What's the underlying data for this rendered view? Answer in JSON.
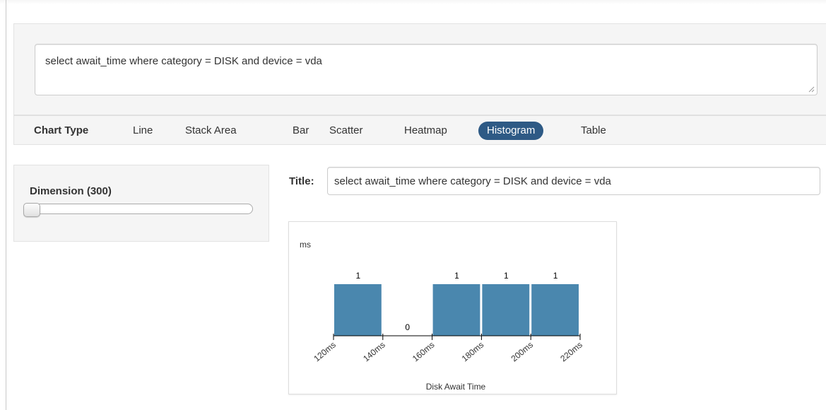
{
  "query": {
    "text": "select await_time where category = DISK and device = vda"
  },
  "chart_type_bar": {
    "label": "Chart Type",
    "options": [
      "Line",
      "Stack Area",
      "Bar",
      "Scatter",
      "Heatmap",
      "Histogram",
      "Table"
    ],
    "active": "Histogram",
    "active_color": "#2e5a85"
  },
  "dimension": {
    "label": "Dimension (300)",
    "slider_position": 0
  },
  "title_field": {
    "label": "Title:",
    "value": "select await_time where category = DISK and device = vda"
  },
  "chart_data": {
    "type": "bar",
    "ylabel": "ms",
    "xlabel": "Disk Await Time",
    "bin_edges": [
      120,
      140,
      160,
      180,
      200,
      220
    ],
    "tick_labels": [
      "120ms",
      "140ms",
      "160ms",
      "180ms",
      "200ms",
      "220ms"
    ],
    "values": [
      1,
      0,
      1,
      1,
      1
    ],
    "value_labels": [
      "1",
      "0",
      "1",
      "1",
      "1"
    ],
    "bar_color": "#4a87ae",
    "ylim": [
      0,
      1
    ]
  }
}
